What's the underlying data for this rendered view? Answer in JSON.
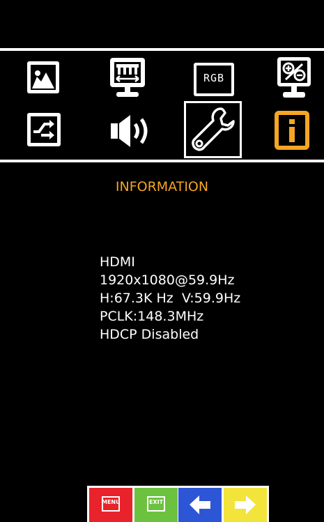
{
  "menu": {
    "items": [
      {
        "icon": "picture-icon"
      },
      {
        "icon": "screen-size-icon"
      },
      {
        "icon": "rgb-icon",
        "label": "RGB"
      },
      {
        "icon": "color-adjust-icon"
      },
      {
        "icon": "input-source-icon"
      },
      {
        "icon": "audio-icon"
      },
      {
        "icon": "setup-wrench-icon",
        "selected": true
      },
      {
        "icon": "information-icon",
        "active": true
      }
    ]
  },
  "page": {
    "title": "INFORMATION"
  },
  "info": {
    "lines": [
      "HDMI",
      "1920x1080@59.9Hz",
      "H:67.3K Hz  V:59.9Hz",
      "PCLK:148.3MHz",
      "HDCP Disabled"
    ]
  },
  "buttons": {
    "menu_label": "MENU",
    "exit_label": "EXIT"
  },
  "colors": {
    "accent": "#F5A623",
    "menu_button": "#E8232B",
    "exit_button": "#6CC23E",
    "left_button": "#2D56D6",
    "right_button": "#F2E43A"
  }
}
